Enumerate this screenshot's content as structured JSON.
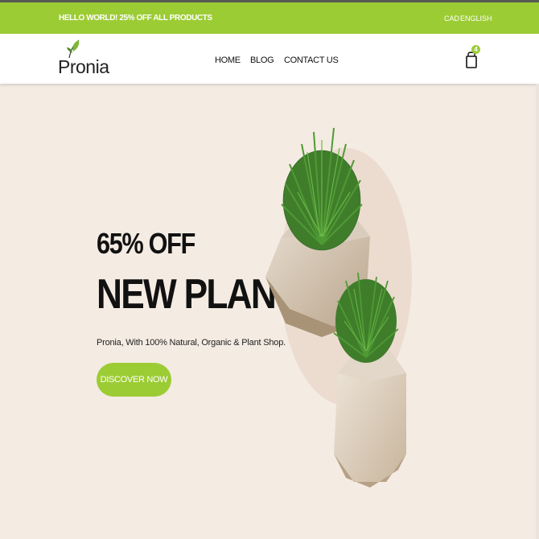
{
  "topbar": {
    "promo": "HELLO WORLD! 25% OFF ALL PRODUCTS",
    "currency": "CAD",
    "language": "ENGLISH"
  },
  "header": {
    "logo": "Pronia",
    "nav": [
      "HOME",
      "BLOG",
      "CONTACT US"
    ],
    "cart_count": "4",
    "cart_icon": "shopping-bag-icon"
  },
  "hero": {
    "discount": "65% OFF",
    "headline": "NEW PLANT",
    "subtitle": "Pronia, With 100% Natural, Organic & Plant Shop.",
    "button": "DISCOVER NOW"
  },
  "colors": {
    "accent": "#9ccc34",
    "hero_bg": "#f4ebe3",
    "text": "#111111"
  }
}
